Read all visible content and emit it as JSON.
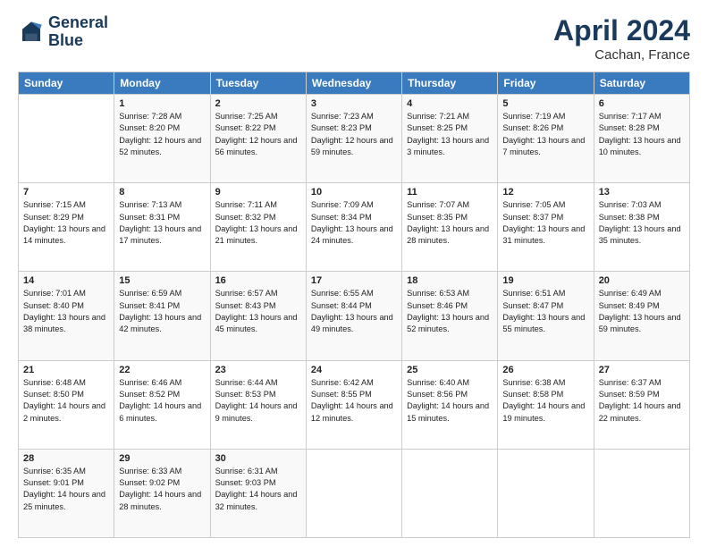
{
  "header": {
    "logo_line1": "General",
    "logo_line2": "Blue",
    "month": "April 2024",
    "location": "Cachan, France"
  },
  "weekdays": [
    "Sunday",
    "Monday",
    "Tuesday",
    "Wednesday",
    "Thursday",
    "Friday",
    "Saturday"
  ],
  "weeks": [
    [
      {
        "day": "",
        "sunrise": "",
        "sunset": "",
        "daylight": ""
      },
      {
        "day": "1",
        "sunrise": "Sunrise: 7:28 AM",
        "sunset": "Sunset: 8:20 PM",
        "daylight": "Daylight: 12 hours and 52 minutes."
      },
      {
        "day": "2",
        "sunrise": "Sunrise: 7:25 AM",
        "sunset": "Sunset: 8:22 PM",
        "daylight": "Daylight: 12 hours and 56 minutes."
      },
      {
        "day": "3",
        "sunrise": "Sunrise: 7:23 AM",
        "sunset": "Sunset: 8:23 PM",
        "daylight": "Daylight: 12 hours and 59 minutes."
      },
      {
        "day": "4",
        "sunrise": "Sunrise: 7:21 AM",
        "sunset": "Sunset: 8:25 PM",
        "daylight": "Daylight: 13 hours and 3 minutes."
      },
      {
        "day": "5",
        "sunrise": "Sunrise: 7:19 AM",
        "sunset": "Sunset: 8:26 PM",
        "daylight": "Daylight: 13 hours and 7 minutes."
      },
      {
        "day": "6",
        "sunrise": "Sunrise: 7:17 AM",
        "sunset": "Sunset: 8:28 PM",
        "daylight": "Daylight: 13 hours and 10 minutes."
      }
    ],
    [
      {
        "day": "7",
        "sunrise": "Sunrise: 7:15 AM",
        "sunset": "Sunset: 8:29 PM",
        "daylight": "Daylight: 13 hours and 14 minutes."
      },
      {
        "day": "8",
        "sunrise": "Sunrise: 7:13 AM",
        "sunset": "Sunset: 8:31 PM",
        "daylight": "Daylight: 13 hours and 17 minutes."
      },
      {
        "day": "9",
        "sunrise": "Sunrise: 7:11 AM",
        "sunset": "Sunset: 8:32 PM",
        "daylight": "Daylight: 13 hours and 21 minutes."
      },
      {
        "day": "10",
        "sunrise": "Sunrise: 7:09 AM",
        "sunset": "Sunset: 8:34 PM",
        "daylight": "Daylight: 13 hours and 24 minutes."
      },
      {
        "day": "11",
        "sunrise": "Sunrise: 7:07 AM",
        "sunset": "Sunset: 8:35 PM",
        "daylight": "Daylight: 13 hours and 28 minutes."
      },
      {
        "day": "12",
        "sunrise": "Sunrise: 7:05 AM",
        "sunset": "Sunset: 8:37 PM",
        "daylight": "Daylight: 13 hours and 31 minutes."
      },
      {
        "day": "13",
        "sunrise": "Sunrise: 7:03 AM",
        "sunset": "Sunset: 8:38 PM",
        "daylight": "Daylight: 13 hours and 35 minutes."
      }
    ],
    [
      {
        "day": "14",
        "sunrise": "Sunrise: 7:01 AM",
        "sunset": "Sunset: 8:40 PM",
        "daylight": "Daylight: 13 hours and 38 minutes."
      },
      {
        "day": "15",
        "sunrise": "Sunrise: 6:59 AM",
        "sunset": "Sunset: 8:41 PM",
        "daylight": "Daylight: 13 hours and 42 minutes."
      },
      {
        "day": "16",
        "sunrise": "Sunrise: 6:57 AM",
        "sunset": "Sunset: 8:43 PM",
        "daylight": "Daylight: 13 hours and 45 minutes."
      },
      {
        "day": "17",
        "sunrise": "Sunrise: 6:55 AM",
        "sunset": "Sunset: 8:44 PM",
        "daylight": "Daylight: 13 hours and 49 minutes."
      },
      {
        "day": "18",
        "sunrise": "Sunrise: 6:53 AM",
        "sunset": "Sunset: 8:46 PM",
        "daylight": "Daylight: 13 hours and 52 minutes."
      },
      {
        "day": "19",
        "sunrise": "Sunrise: 6:51 AM",
        "sunset": "Sunset: 8:47 PM",
        "daylight": "Daylight: 13 hours and 55 minutes."
      },
      {
        "day": "20",
        "sunrise": "Sunrise: 6:49 AM",
        "sunset": "Sunset: 8:49 PM",
        "daylight": "Daylight: 13 hours and 59 minutes."
      }
    ],
    [
      {
        "day": "21",
        "sunrise": "Sunrise: 6:48 AM",
        "sunset": "Sunset: 8:50 PM",
        "daylight": "Daylight: 14 hours and 2 minutes."
      },
      {
        "day": "22",
        "sunrise": "Sunrise: 6:46 AM",
        "sunset": "Sunset: 8:52 PM",
        "daylight": "Daylight: 14 hours and 6 minutes."
      },
      {
        "day": "23",
        "sunrise": "Sunrise: 6:44 AM",
        "sunset": "Sunset: 8:53 PM",
        "daylight": "Daylight: 14 hours and 9 minutes."
      },
      {
        "day": "24",
        "sunrise": "Sunrise: 6:42 AM",
        "sunset": "Sunset: 8:55 PM",
        "daylight": "Daylight: 14 hours and 12 minutes."
      },
      {
        "day": "25",
        "sunrise": "Sunrise: 6:40 AM",
        "sunset": "Sunset: 8:56 PM",
        "daylight": "Daylight: 14 hours and 15 minutes."
      },
      {
        "day": "26",
        "sunrise": "Sunrise: 6:38 AM",
        "sunset": "Sunset: 8:58 PM",
        "daylight": "Daylight: 14 hours and 19 minutes."
      },
      {
        "day": "27",
        "sunrise": "Sunrise: 6:37 AM",
        "sunset": "Sunset: 8:59 PM",
        "daylight": "Daylight: 14 hours and 22 minutes."
      }
    ],
    [
      {
        "day": "28",
        "sunrise": "Sunrise: 6:35 AM",
        "sunset": "Sunset: 9:01 PM",
        "daylight": "Daylight: 14 hours and 25 minutes."
      },
      {
        "day": "29",
        "sunrise": "Sunrise: 6:33 AM",
        "sunset": "Sunset: 9:02 PM",
        "daylight": "Daylight: 14 hours and 28 minutes."
      },
      {
        "day": "30",
        "sunrise": "Sunrise: 6:31 AM",
        "sunset": "Sunset: 9:03 PM",
        "daylight": "Daylight: 14 hours and 32 minutes."
      },
      {
        "day": "",
        "sunrise": "",
        "sunset": "",
        "daylight": ""
      },
      {
        "day": "",
        "sunrise": "",
        "sunset": "",
        "daylight": ""
      },
      {
        "day": "",
        "sunrise": "",
        "sunset": "",
        "daylight": ""
      },
      {
        "day": "",
        "sunrise": "",
        "sunset": "",
        "daylight": ""
      }
    ]
  ]
}
